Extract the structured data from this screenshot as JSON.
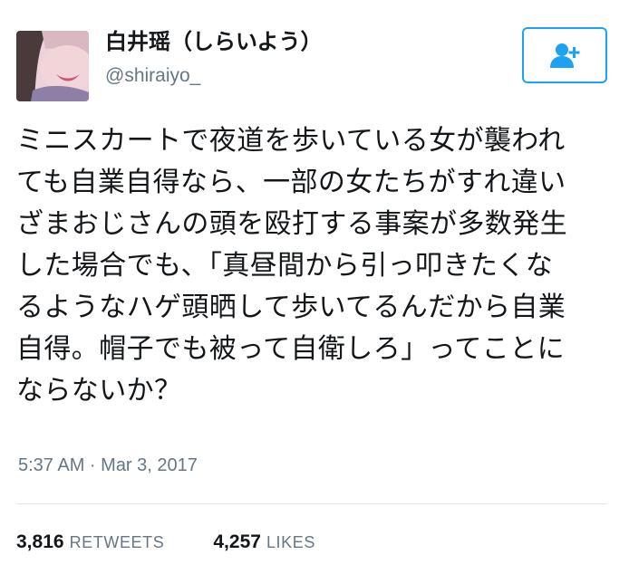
{
  "user": {
    "display_name": "白井瑶（しらいよう）",
    "handle": "@shiraiyo_"
  },
  "follow_button": {
    "icon": "add-user-icon",
    "color": "#1da1f2"
  },
  "tweet": {
    "text_lines": [
      "ミニスカートで夜道を歩いている女が襲われ",
      "ても自業自得なら、一部の女たちがすれ違い",
      "ざまおじさんの頭を殴打する事案が多数発生",
      "した場合でも、「真昼間から引っ叩きたくな",
      "るようなハゲ頭晒して歩いてるんだから自業",
      "自得。帽子でも被って自衛しろ」ってことに",
      "ならないか？"
    ],
    "timestamp": "5:37 AM · Mar 3, 2017"
  },
  "stats": {
    "retweets_count": "3,816",
    "retweets_label": "RETWEETS",
    "likes_count": "4,257",
    "likes_label": "LIKES"
  },
  "colors": {
    "text": "#14171a",
    "secondary": "#657786",
    "accent": "#1da1f2",
    "divider": "#e1e8ed"
  }
}
